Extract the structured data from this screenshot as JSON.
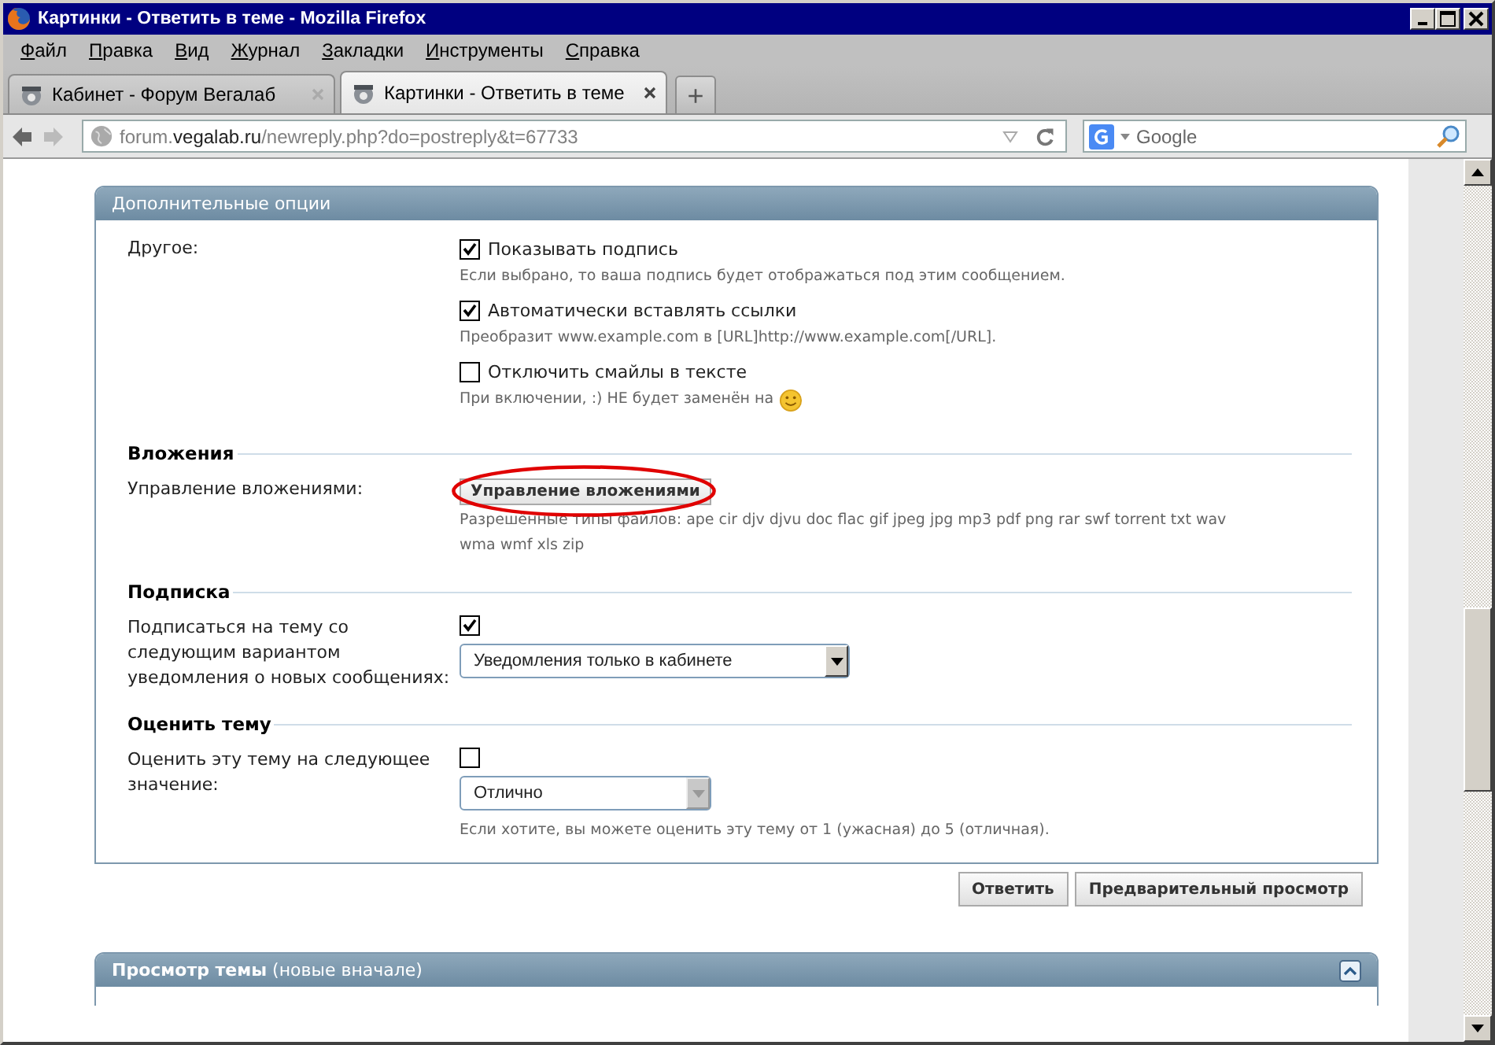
{
  "window": {
    "title": "Картинки - Ответить в теме - Mozilla Firefox"
  },
  "menu": [
    "Файл",
    "Правка",
    "Вид",
    "Журнал",
    "Закладки",
    "Инструменты",
    "Справка"
  ],
  "tabs": [
    {
      "label": "Кабинет - Форум Вегалаб",
      "selected": false
    },
    {
      "label": "Картинки - Ответить в теме",
      "selected": true
    }
  ],
  "new_tab": "+",
  "address": {
    "prefix": "forum.",
    "domain": "vegalab.ru",
    "path": "/newreply.php?do=postreply&t=67733"
  },
  "search": {
    "placeholder": "Google"
  },
  "options_panel": {
    "title": "Дополнительные опции",
    "other": {
      "label": "Другое:",
      "options": [
        {
          "label": "Показывать подпись",
          "checked": true,
          "hint": "Если выбрано, то ваша подпись будет отображаться под этим сообщением.",
          "smiley": false
        },
        {
          "label": "Автоматически вставлять ссылки",
          "checked": true,
          "hint": "Преобразит www.example.com в [URL]http://www.example.com[/URL].",
          "smiley": false
        },
        {
          "label": "Отключить смайлы в тексте",
          "checked": false,
          "hint": "При включении, :) НЕ будет заменён на",
          "smiley": true
        }
      ]
    },
    "attachments": {
      "heading": "Вложения",
      "label": "Управление вложениями:",
      "button": "Управление вложениями",
      "highlighted": true,
      "hint": "Разрешённые типы файлов: ape cir djv djvu doc flac gif jpeg jpg mp3 pdf png rar swf torrent txt wav wma wmf xls zip"
    },
    "subscription": {
      "heading": "Подписка",
      "label": [
        "Подписаться на тему со",
        "следующим вариантом",
        "уведомления о новых сообщениях:"
      ],
      "checked": true,
      "select": "Уведомления только в кабинете"
    },
    "rating": {
      "heading": "Оценить тему",
      "label": "Оценить эту тему на следующее значение:",
      "checked": false,
      "select": "Отлично",
      "hint": "Если хотите, вы можете оценить эту тему от 1 (ужасная) до 5 (отличная)."
    }
  },
  "buttons": [
    "Ответить",
    "Предварительный просмотр"
  ],
  "preview_panel": {
    "title": "**Просмотр темы** (новые вначале)"
  }
}
